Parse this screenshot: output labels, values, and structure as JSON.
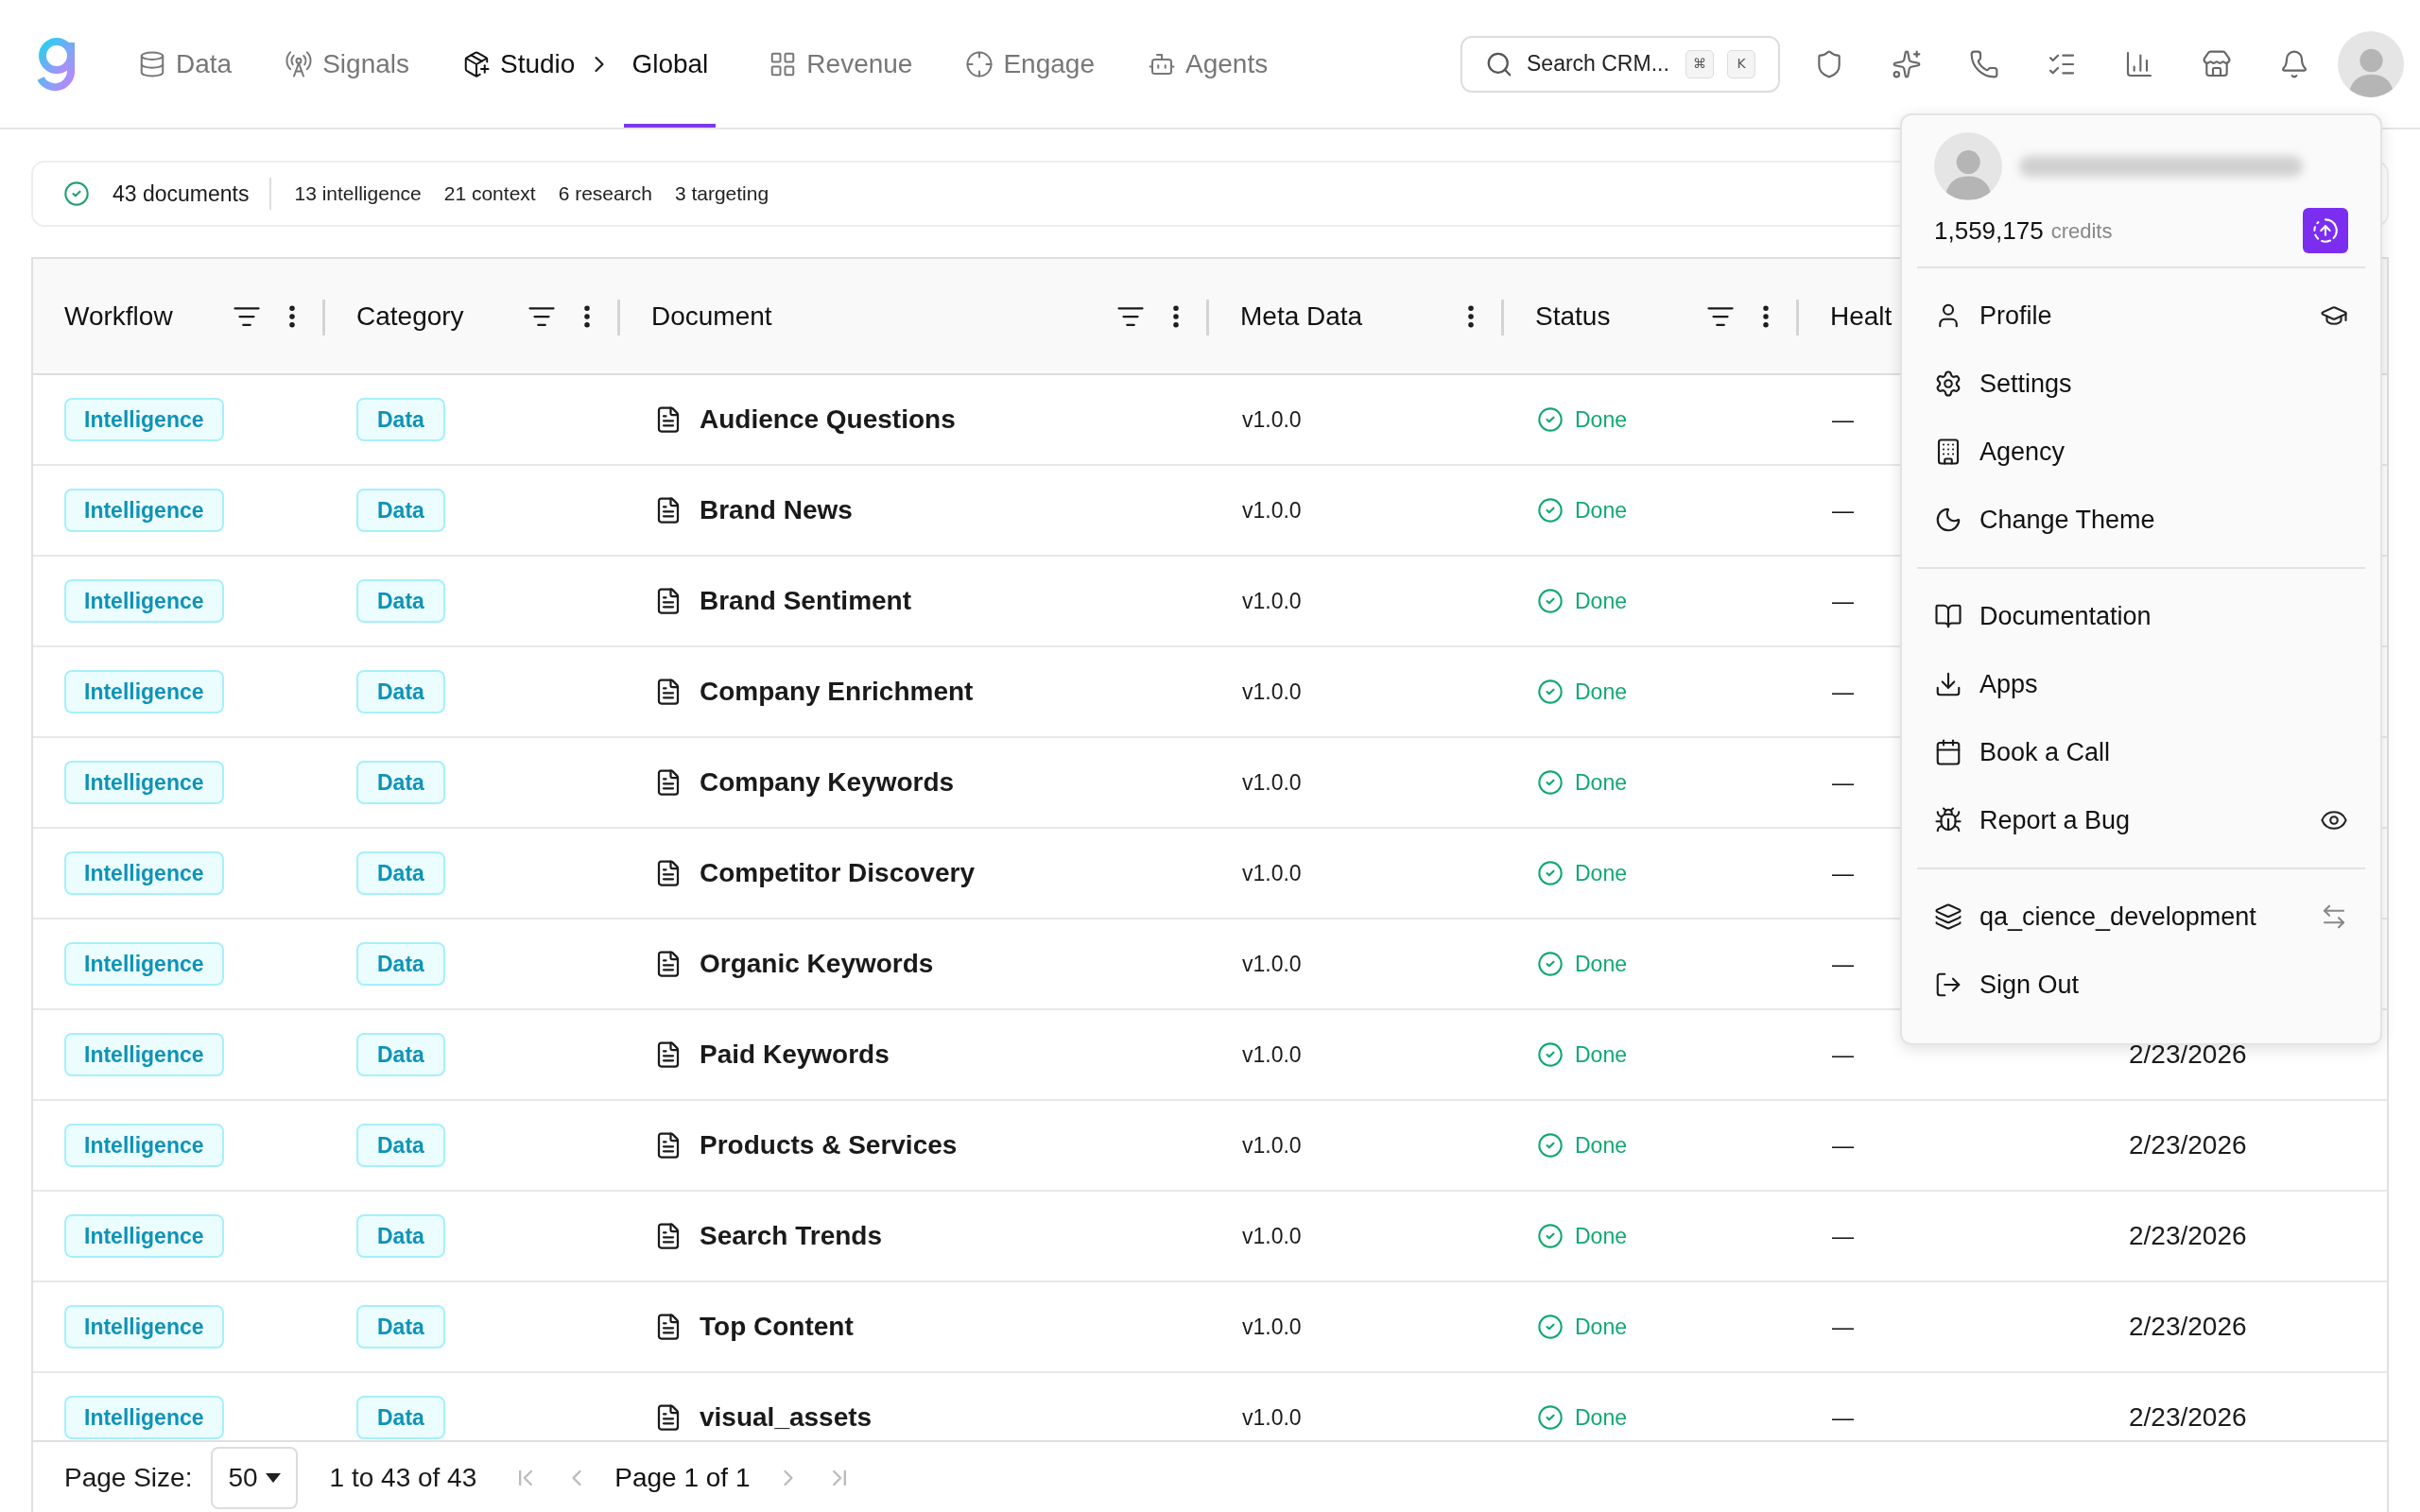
{
  "nav": {
    "items": [
      {
        "label": "Data",
        "selected": false
      },
      {
        "label": "Signals",
        "selected": false
      },
      {
        "label": "Studio",
        "selected": true,
        "breadcrumb": "Global"
      },
      {
        "label": "Revenue",
        "selected": false
      },
      {
        "label": "Engage",
        "selected": false
      },
      {
        "label": "Agents",
        "selected": false
      }
    ]
  },
  "search": {
    "placeholder": "Search CRM...",
    "keys": [
      "⌘",
      "K"
    ]
  },
  "summary": {
    "total": "43 documents",
    "counts": [
      "13 intelligence",
      "21 context",
      "6 research",
      "3 targeting"
    ]
  },
  "table": {
    "columns": [
      {
        "label": "Workflow",
        "filter": true
      },
      {
        "label": "Category",
        "filter": true
      },
      {
        "label": "Document",
        "filter": true
      },
      {
        "label": "Meta Data",
        "filter": false
      },
      {
        "label": "Status",
        "filter": true
      },
      {
        "label": "Healt"
      }
    ],
    "rows": [
      {
        "workflow": "Intelligence",
        "category": "Data",
        "document": "Audience Questions",
        "meta": "v1.0.0",
        "status": "Done",
        "health": "—"
      },
      {
        "workflow": "Intelligence",
        "category": "Data",
        "document": "Brand News",
        "meta": "v1.0.0",
        "status": "Done",
        "health": "—"
      },
      {
        "workflow": "Intelligence",
        "category": "Data",
        "document": "Brand Sentiment",
        "meta": "v1.0.0",
        "status": "Done",
        "health": "—"
      },
      {
        "workflow": "Intelligence",
        "category": "Data",
        "document": "Company Enrichment",
        "meta": "v1.0.0",
        "status": "Done",
        "health": "—"
      },
      {
        "workflow": "Intelligence",
        "category": "Data",
        "document": "Company Keywords",
        "meta": "v1.0.0",
        "status": "Done",
        "health": "—"
      },
      {
        "workflow": "Intelligence",
        "category": "Data",
        "document": "Competitor Discovery",
        "meta": "v1.0.0",
        "status": "Done",
        "health": "—"
      },
      {
        "workflow": "Intelligence",
        "category": "Data",
        "document": "Organic Keywords",
        "meta": "v1.0.0",
        "status": "Done",
        "health": "—"
      },
      {
        "workflow": "Intelligence",
        "category": "Data",
        "document": "Paid Keywords",
        "meta": "v1.0.0",
        "status": "Done",
        "health": "—",
        "date": "2/23/2026"
      },
      {
        "workflow": "Intelligence",
        "category": "Data",
        "document": "Products & Services",
        "meta": "v1.0.0",
        "status": "Done",
        "health": "—",
        "date": "2/23/2026"
      },
      {
        "workflow": "Intelligence",
        "category": "Data",
        "document": "Search Trends",
        "meta": "v1.0.0",
        "status": "Done",
        "health": "—",
        "date": "2/23/2026"
      },
      {
        "workflow": "Intelligence",
        "category": "Data",
        "document": "Top Content",
        "meta": "v1.0.0",
        "status": "Done",
        "health": "—",
        "date": "2/23/2026"
      },
      {
        "workflow": "Intelligence",
        "category": "Data",
        "document": "visual_assets",
        "meta": "v1.0.0",
        "status": "Done",
        "health": "—",
        "date": "2/23/2026"
      }
    ]
  },
  "pagination": {
    "page_size_label": "Page Size:",
    "page_size": "50",
    "range": "1 to 43 of 43",
    "page": "Page 1 of 1"
  },
  "menu": {
    "credits": "1,559,175",
    "credits_label": "credits",
    "sections": [
      [
        "Profile",
        "Settings",
        "Agency",
        "Change Theme"
      ],
      [
        "Documentation",
        "Apps",
        "Book a Call",
        "Report a Bug"
      ],
      [
        "qa_cience_development",
        "Sign Out"
      ]
    ]
  }
}
